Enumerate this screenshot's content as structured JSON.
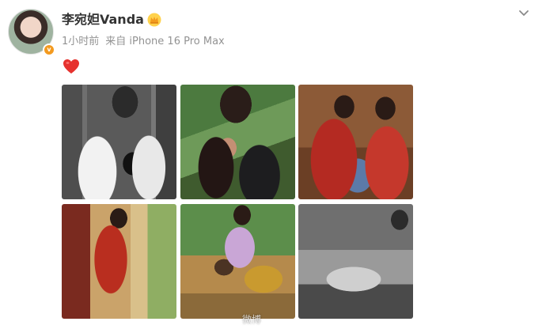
{
  "post": {
    "author": {
      "name": "李宛妲Vanda",
      "verified_badge": "v",
      "avatar_icon": "avatar",
      "crown_icon": "crown-icon"
    },
    "meta": {
      "time": "1小时前",
      "source": "来自 iPhone 16 Pro Max"
    },
    "content_emoji": "heart-emoji",
    "photos": [
      {
        "name": "photo-1"
      },
      {
        "name": "photo-2"
      },
      {
        "name": "photo-3"
      },
      {
        "name": "photo-4"
      },
      {
        "name": "photo-5"
      },
      {
        "name": "photo-6"
      }
    ],
    "watermark": "微博"
  },
  "colors": {
    "username": "#333333",
    "meta": "#939393",
    "badge": "#f39a1f",
    "heart": "#e6322e"
  }
}
